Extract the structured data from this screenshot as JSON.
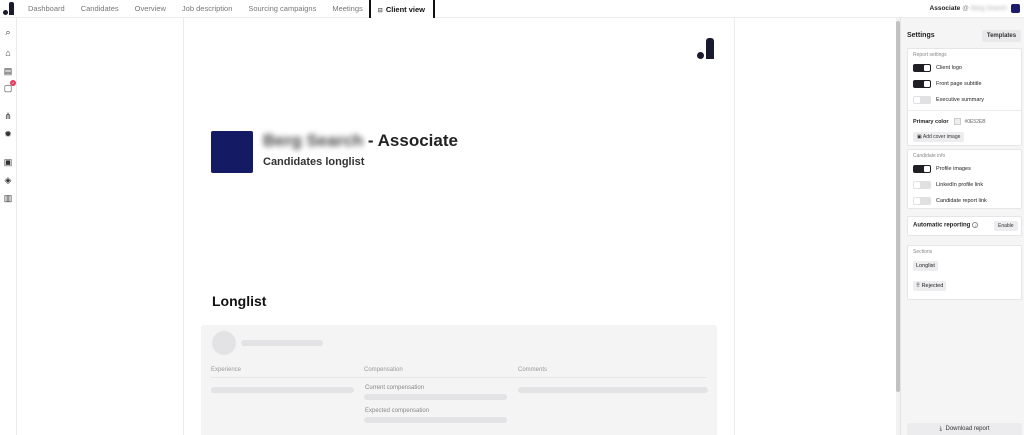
{
  "nav": {
    "tabs": [
      {
        "label": "Dashboard"
      },
      {
        "label": "Candidates"
      },
      {
        "label": "Overview"
      },
      {
        "label": "Job description"
      },
      {
        "label": "Sourcing campaigns"
      },
      {
        "label": "Meetings"
      },
      {
        "label": "Client view"
      }
    ],
    "role": "Associate",
    "at": "@",
    "company": "Berg Search"
  },
  "sidebar": {
    "icons": [
      {
        "name": "search-icon",
        "glyph": "⌕"
      },
      {
        "name": "home-icon",
        "glyph": "⌂"
      },
      {
        "name": "chat-icon",
        "glyph": "▤"
      },
      {
        "name": "tasks-icon",
        "glyph": "▢",
        "badge": "2"
      },
      {
        "name": "network-icon",
        "glyph": "⋔"
      },
      {
        "name": "bug-icon",
        "glyph": "✹"
      },
      {
        "name": "briefcase-icon",
        "glyph": "▣"
      },
      {
        "name": "tag-icon",
        "glyph": "◈"
      },
      {
        "name": "building-icon",
        "glyph": "▥"
      }
    ]
  },
  "report": {
    "company": "Berg Search",
    "title_suffix": " - Associate",
    "subtitle": "Candidates longlist",
    "section_title": "Longlist",
    "columns": {
      "experience": "Experience",
      "compensation": "Compensation",
      "comments": "Comments"
    },
    "current_compensation": "Current compensation",
    "expected_compensation": "Expected compensation"
  },
  "settings": {
    "title": "Settings",
    "templates_label": "Templates",
    "report_settings": {
      "title": "Report settings",
      "client_logo": {
        "label": "Client logo",
        "on": true
      },
      "front_page_subtitle": {
        "label": "Front page subtitle",
        "on": true
      },
      "executive_summary": {
        "label": "Executive summary",
        "on": false
      },
      "primary_color_label": "Primary color",
      "primary_color_value": "#0E52EB",
      "add_cover_label": "Add cover image"
    },
    "candidate_info": {
      "title": "Candidate info",
      "profile_images": {
        "label": "Profile images",
        "on": true
      },
      "linkedin_profile_link": {
        "label": "LinkedIn profile link",
        "on": false
      },
      "candidate_report_link": {
        "label": "Candidate report link",
        "on": false
      }
    },
    "automatic_reporting": {
      "label": "Automatic reporting",
      "enable_label": "Enable"
    },
    "sections": {
      "title": "Sections",
      "longlist": "Longlist",
      "rejected": "Rejected"
    },
    "download_label": "Download report"
  },
  "colors": {
    "accent": "#141a63",
    "toggle_on": "#1f1f24",
    "toggle_off": "#e1e1e4"
  }
}
